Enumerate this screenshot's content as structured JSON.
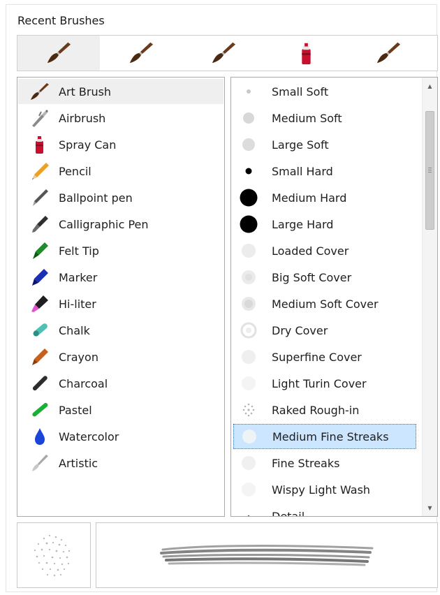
{
  "panel": {
    "title": "Recent Brushes"
  },
  "recent_brushes": [
    {
      "icon": "art-brush-icon",
      "selected": true
    },
    {
      "icon": "art-brush-icon",
      "selected": false
    },
    {
      "icon": "art-brush-icon",
      "selected": false
    },
    {
      "icon": "spray-can-icon",
      "selected": false
    },
    {
      "icon": "art-brush-icon",
      "selected": false
    }
  ],
  "categories": {
    "selected": "Art Brush",
    "items": [
      {
        "label": "Art Brush",
        "icon": "art-brush-icon"
      },
      {
        "label": "Airbrush",
        "icon": "airbrush-icon"
      },
      {
        "label": "Spray Can",
        "icon": "spray-can-icon"
      },
      {
        "label": "Pencil",
        "icon": "pencil-icon"
      },
      {
        "label": "Ballpoint pen",
        "icon": "ballpoint-pen-icon"
      },
      {
        "label": "Calligraphic Pen",
        "icon": "calligraphic-pen-icon"
      },
      {
        "label": "Felt Tip",
        "icon": "felt-tip-icon"
      },
      {
        "label": "Marker",
        "icon": "marker-icon"
      },
      {
        "label": "Hi-liter",
        "icon": "hi-liter-icon"
      },
      {
        "label": "Chalk",
        "icon": "chalk-icon"
      },
      {
        "label": "Crayon",
        "icon": "crayon-icon"
      },
      {
        "label": "Charcoal",
        "icon": "charcoal-icon"
      },
      {
        "label": "Pastel",
        "icon": "pastel-icon"
      },
      {
        "label": "Watercolor",
        "icon": "watercolor-icon"
      },
      {
        "label": "Artistic",
        "icon": "artistic-icon"
      }
    ]
  },
  "variants": {
    "selected": "Medium Fine Streaks",
    "items": [
      {
        "label": "Small Soft"
      },
      {
        "label": "Medium Soft"
      },
      {
        "label": "Large Soft"
      },
      {
        "label": "Small Hard"
      },
      {
        "label": "Medium Hard"
      },
      {
        "label": "Large Hard"
      },
      {
        "label": "Loaded Cover"
      },
      {
        "label": "Big Soft Cover"
      },
      {
        "label": "Medium Soft Cover"
      },
      {
        "label": "Dry Cover"
      },
      {
        "label": "Superfine Cover"
      },
      {
        "label": "Light Turin Cover"
      },
      {
        "label": "Raked Rough-in"
      },
      {
        "label": "Medium Fine Streaks"
      },
      {
        "label": "Fine Streaks"
      },
      {
        "label": "Wispy Light Wash"
      },
      {
        "label": "Detail"
      }
    ]
  },
  "colors": {
    "selection_fill": "#cce6ff",
    "selection_border": "#3a6fb8",
    "panel_border": "#a9a9a9"
  }
}
